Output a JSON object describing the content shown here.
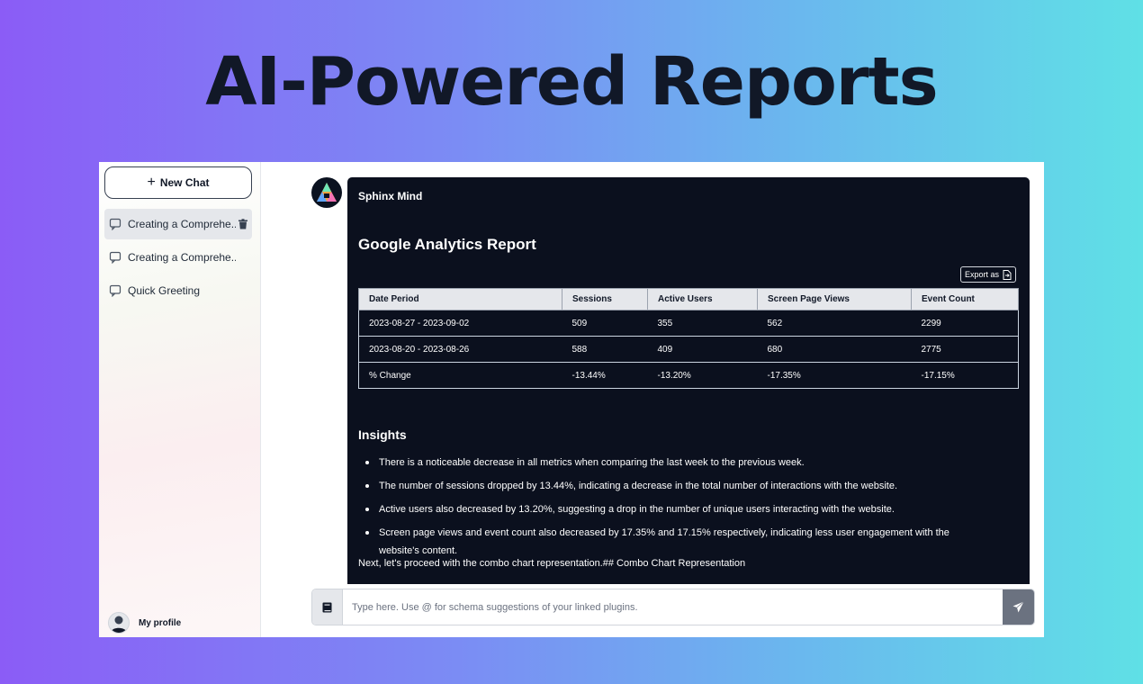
{
  "hero": {
    "title": "AI-Powered Reports"
  },
  "sidebar": {
    "new_chat_label": "New Chat",
    "chats": [
      {
        "label": "Creating a Comprehe..."
      },
      {
        "label": "Creating a Comprehe..."
      },
      {
        "label": "Quick Greeting"
      }
    ],
    "profile_label": "My profile"
  },
  "message": {
    "sender": "Sphinx Mind",
    "report_title": "Google Analytics Report",
    "export_label": "Export as",
    "table": {
      "headers": [
        "Date Period",
        "Sessions",
        "Active Users",
        "Screen Page Views",
        "Event Count"
      ],
      "rows": [
        [
          "2023-08-27 - 2023-09-02",
          "509",
          "355",
          "562",
          "2299"
        ],
        [
          "2023-08-20 - 2023-08-26",
          "588",
          "409",
          "680",
          "2775"
        ],
        [
          "% Change",
          "-13.44%",
          "-13.20%",
          "-17.35%",
          "-17.15%"
        ]
      ]
    },
    "insights_title": "Insights",
    "insights": [
      "There is a noticeable decrease in all metrics when comparing the last week to the previous week.",
      "The number of sessions dropped by 13.44%, indicating a decrease in the total number of interactions with the website.",
      "Active users also decreased by 13.20%, suggesting a drop in the number of unique users interacting with the website.",
      "Screen page views and event count also decreased by 17.35% and 17.15% respectively, indicating less user engagement with the website's content."
    ],
    "next_line": "Next, let's proceed with the combo chart representation.## Combo Chart Representation"
  },
  "input": {
    "placeholder": "Type here. Use @ for schema suggestions of your linked plugins."
  },
  "icons": {
    "new_chat": "plus-icon",
    "chat": "chat-bubble-icon",
    "delete": "trash-icon",
    "export": "file-export-icon",
    "book": "book-icon",
    "send": "paper-plane-icon"
  },
  "colors": {
    "message_bg": "#0b101e",
    "table_header_bg": "#e5e7eb",
    "send_button": "#6b7280"
  }
}
